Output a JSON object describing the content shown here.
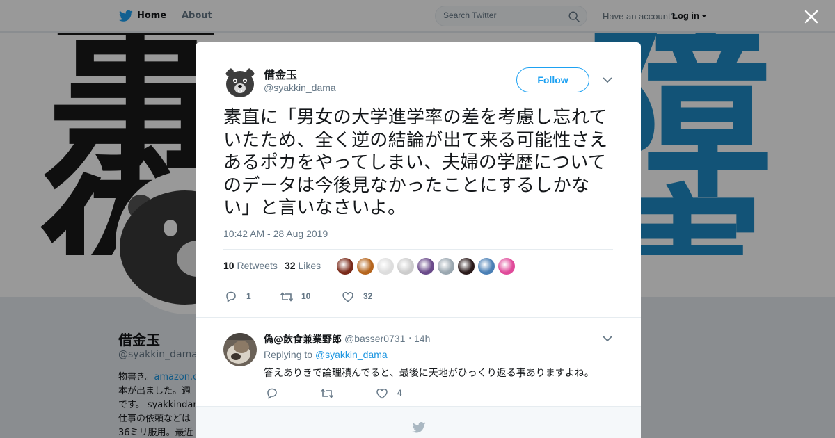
{
  "nav": {
    "home_label": "Home",
    "about_label": "About",
    "search_placeholder": "Search Twitter",
    "have_account": "Have an account?",
    "login_label": "Log in",
    "brand_color": "#1da1f2"
  },
  "profile": {
    "name": "借金玉",
    "handle": "@syakkin_dama",
    "bio_lines": [
      {
        "prefix": "物書き。",
        "link": "amazon.c"
      },
      {
        "prefix": "本が出ました。週",
        "link": ""
      },
      {
        "prefix": "です。 syakkindar",
        "link": ""
      },
      {
        "prefix": "仕事の依頼などは",
        "link": ""
      },
      {
        "prefix": "36ミリ服用。最近",
        "link": ""
      }
    ],
    "banner_kanji": [
      "事",
      "術",
      "障",
      "害"
    ]
  },
  "tweet": {
    "author_name": "借金玉",
    "author_handle": "@syakkin_dama",
    "follow_label": "Follow",
    "text": "素直に「男女の大学進学率の差を考慮し忘れていたため、全く逆の結論が出て来る可能性さえあるポカをやってしまい、夫婦の学歴についてのデータは今後見なかったことにするしかない」と言いなさいよ。",
    "timestamp": "10:42 AM - 28 Aug 2019",
    "retweets_count": "10",
    "retweets_label": "Retweets",
    "likes_count": "32",
    "likes_label": "Likes",
    "liker_colors": [
      "#7a2a1a",
      "#b5651d",
      "#dddddd",
      "#cccccc",
      "#6a4a8a",
      "#9aa7b0",
      "#2a1a1a",
      "#4a7fb5",
      "#e04a9a"
    ],
    "actions": {
      "reply_count": "1",
      "retweet_count": "10",
      "like_count": "32"
    }
  },
  "reply": {
    "author_name": "偽@飲食兼業野郎",
    "author_handle": "@basser0731",
    "separator": "·",
    "time": "14h",
    "replying_prefix": "Replying to",
    "replying_to": "@syakkin_dama",
    "text": "答えありきで論理積んでると、最後に天地がひっくり返る事ありますよね。",
    "actions": {
      "reply_count": "",
      "retweet_count": "",
      "like_count": "4"
    }
  }
}
